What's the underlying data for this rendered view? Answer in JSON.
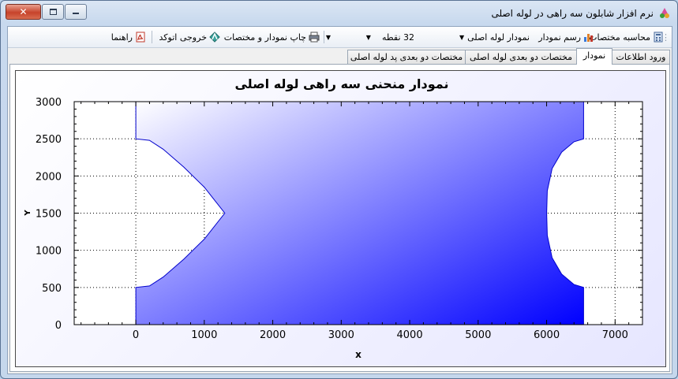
{
  "window": {
    "title": "نرم افزار شابلون سه راهی در لوله اصلی",
    "close_symbol": "✕"
  },
  "toolbar": {
    "calc_label": "محاسبه مختصات",
    "draw_label": "رسم نمودار",
    "graph_select": "نمودار لوله اصلی",
    "points_select": "32 نقطه",
    "print_label": "چاپ نمودار و مختصات",
    "autocad_label": "خروجی اتوکد",
    "help_label": "راهنما"
  },
  "tabs": [
    {
      "label": "ورود اطلاعات",
      "active": false
    },
    {
      "label": "نمودار",
      "active": true
    },
    {
      "label": "مختصات دو بعدی لوله اصلی",
      "active": false
    },
    {
      "label": "مختصات دو بعدی پد لوله اصلی",
      "active": false
    }
  ],
  "chart_data": {
    "type": "area",
    "title": "نمودار منحنی سه راهی لوله اصلی",
    "xlabel": "x",
    "ylabel": "Y",
    "xlim": [
      -900,
      7400
    ],
    "ylim": [
      0,
      3000
    ],
    "xticks": [
      0,
      1000,
      2000,
      3000,
      4000,
      5000,
      6000,
      7000
    ],
    "yticks": [
      0,
      500,
      1000,
      1500,
      2000,
      2500,
      3000
    ],
    "grid": true,
    "fill_gradient": [
      "#ffffff",
      "#0000ff"
    ],
    "outline_color": "#0000cc",
    "series": [
      {
        "points": [
          [
            0,
            0
          ],
          [
            0,
            500
          ],
          [
            200,
            520
          ],
          [
            400,
            640
          ],
          [
            700,
            880
          ],
          [
            1000,
            1150
          ],
          [
            1300,
            1500
          ],
          [
            1000,
            1850
          ],
          [
            700,
            2120
          ],
          [
            400,
            2360
          ],
          [
            200,
            2480
          ],
          [
            0,
            2500
          ],
          [
            0,
            3000
          ],
          [
            6540,
            3000
          ],
          [
            6540,
            2500
          ],
          [
            6400,
            2460
          ],
          [
            6220,
            2320
          ],
          [
            6080,
            2100
          ],
          [
            6010,
            1800
          ],
          [
            6000,
            1500
          ],
          [
            6010,
            1200
          ],
          [
            6080,
            900
          ],
          [
            6220,
            680
          ],
          [
            6400,
            540
          ],
          [
            6540,
            500
          ],
          [
            6540,
            0
          ]
        ]
      }
    ]
  }
}
